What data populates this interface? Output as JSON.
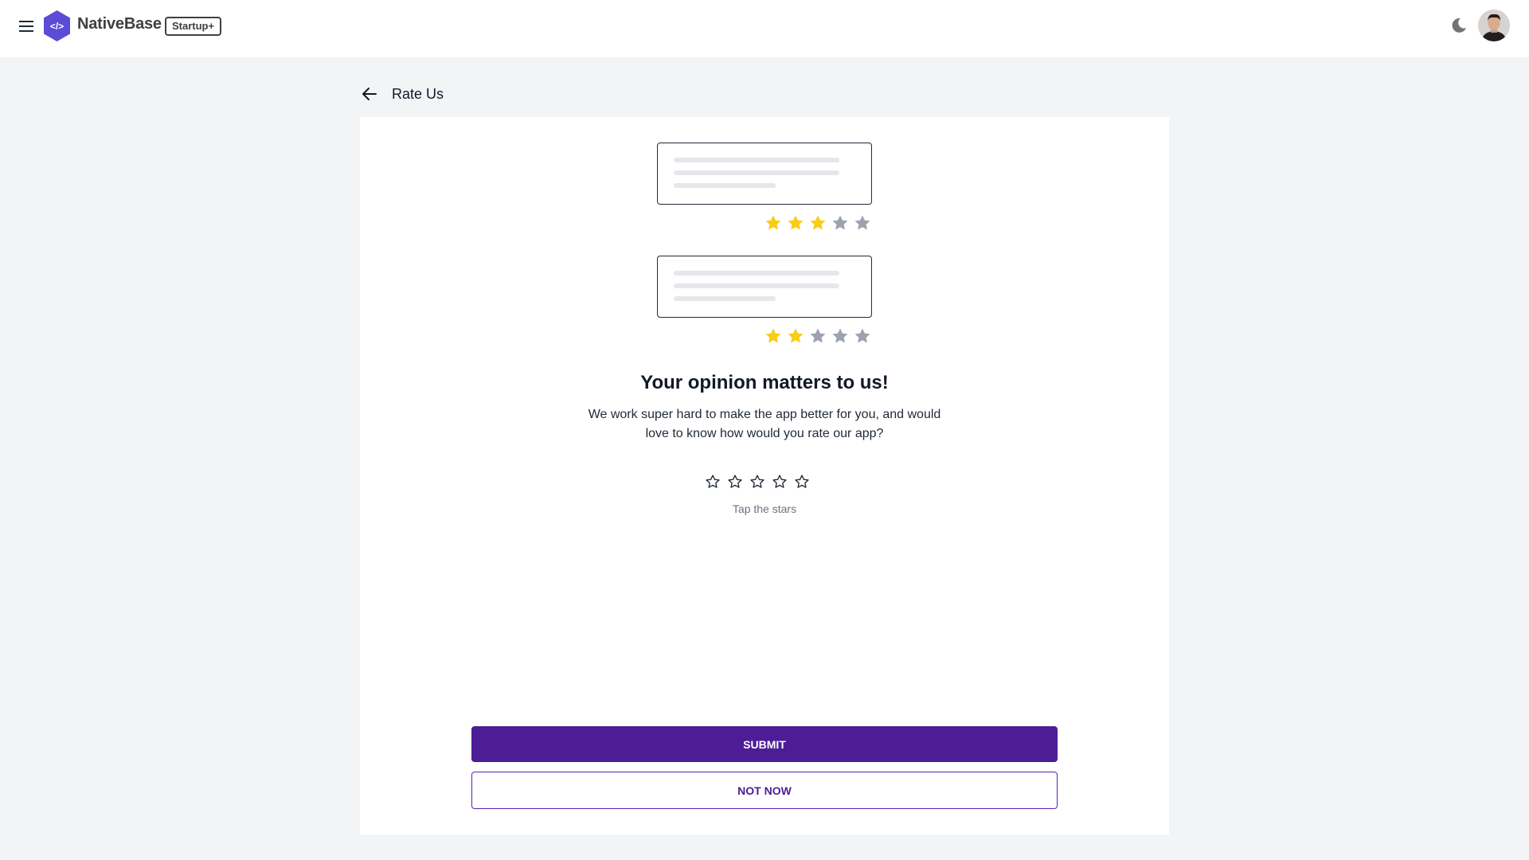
{
  "header": {
    "brand": "NativeBase",
    "badge": "Startup+"
  },
  "page": {
    "title": "Rate Us"
  },
  "illustration": {
    "reviews": [
      {
        "filled_stars": 3,
        "total_stars": 5
      },
      {
        "filled_stars": 2,
        "total_stars": 5
      }
    ]
  },
  "content": {
    "heading": "Your opinion matters to us!",
    "description": "We work super hard to make the app better for you, and would love to know how would you rate our app?",
    "tap_hint": "Tap the stars",
    "rating": {
      "value": 0,
      "max": 5
    }
  },
  "actions": {
    "submit_label": "SUBMIT",
    "not_now_label": "NOT NOW"
  },
  "colors": {
    "primary": "#4c1d95",
    "star_filled": "#facc15",
    "star_empty": "#9ca3af",
    "logo": "#5b4bd6"
  },
  "icons": {
    "menu": "hamburger-menu-icon",
    "logo": "code-hexagon-logo",
    "theme": "moon-icon",
    "back": "arrow-left-icon",
    "star": "star-icon"
  }
}
